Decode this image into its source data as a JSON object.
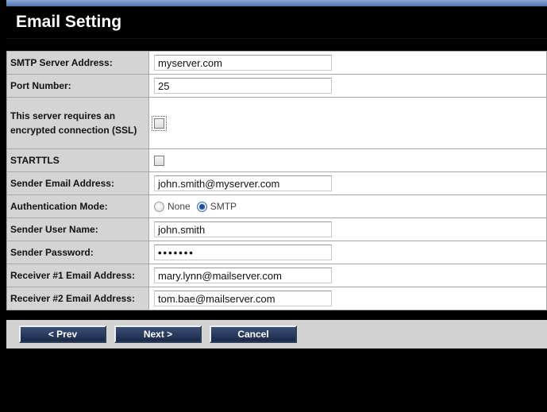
{
  "page": {
    "title": "Email Setting"
  },
  "form": {
    "smtp_server": {
      "label": "SMTP Server Address:",
      "value": "myserver.com"
    },
    "port": {
      "label": "Port Number:",
      "value": "25"
    },
    "ssl": {
      "label": "This server requires an encrypted connection (SSL)",
      "checked": false
    },
    "starttls": {
      "label": "STARTTLS",
      "checked": false
    },
    "sender_email": {
      "label": "Sender Email Address:",
      "value": "john.smith@myserver.com"
    },
    "auth_mode": {
      "label": "Authentication Mode:",
      "options": [
        "None",
        "SMTP"
      ],
      "selected": "SMTP"
    },
    "sender_user": {
      "label": "Sender User Name:",
      "value": "john.smith"
    },
    "sender_password": {
      "label": "Sender Password:",
      "value": "•••••••"
    },
    "receiver1": {
      "label": "Receiver #1 Email Address:",
      "value": "mary.lynn@mailserver.com"
    },
    "receiver2": {
      "label": "Receiver #2 Email Address:",
      "value": "tom.bae@mailserver.com"
    }
  },
  "buttons": {
    "prev": "< Prev",
    "next": "Next >",
    "cancel": "Cancel"
  },
  "colors": {
    "accent": "#1a2a48",
    "label_bg": "#d4d4d4",
    "header_strip": "#4f72b0"
  }
}
